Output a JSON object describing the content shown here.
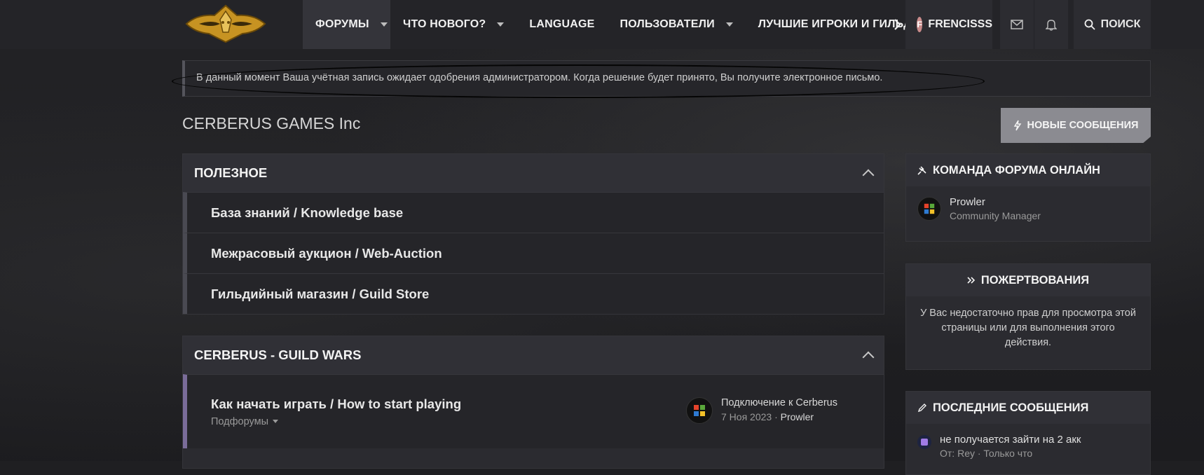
{
  "nav": {
    "items": [
      {
        "label": "ФОРУМЫ",
        "active": true,
        "dropdown": true
      },
      {
        "label": "ЧТО НОВОГО?",
        "dropdown": true
      },
      {
        "label": "LANGUAGE",
        "dropdown": false
      },
      {
        "label": "ПОЛЬЗОВАТЕЛИ",
        "dropdown": true
      },
      {
        "label": "ЛУЧШИЕ ИГРОКИ И ГИЛЬДИ",
        "dropdown": false
      }
    ],
    "more_icon": "chevron-right-icon",
    "user": {
      "initial": "F",
      "name": "FRENCISSS"
    },
    "mail_icon": "mail-icon",
    "bell_icon": "bell-icon",
    "search_label": "ПОИСК"
  },
  "notice": {
    "text": "В данный момент Ваша учётная запись ожидает одобрения администратором. Когда решение будет принято, Вы получите электронное письмо."
  },
  "page": {
    "title": "CERBERUS GAMES Inc",
    "new_posts_label": "НОВЫЕ СООБЩЕНИЯ"
  },
  "categories": [
    {
      "title": "ПОЛЕЗНОЕ",
      "forums": [
        {
          "title": "База знаний / Knowledge base"
        },
        {
          "title": "Межрасовый аукцион / Web-Auction"
        },
        {
          "title": "Гильдийный магазин / Guild Store"
        }
      ]
    },
    {
      "title": "CERBERUS - GUILD WARS",
      "forums": [
        {
          "title": "Как начать играть / How to start playing",
          "subforums_label": "Подфорумы",
          "last_post": {
            "title": "Подключение к Cerberus",
            "date": "7 Ноя 2023",
            "sep": "·",
            "author": "Prowler"
          }
        }
      ]
    }
  ],
  "sidebar": {
    "staff": {
      "title": "КОМАНДА ФОРУМА ОНЛАЙН",
      "member": {
        "name": "Prowler",
        "role": "Community Manager"
      }
    },
    "donations": {
      "title": "ПОЖЕРТВОВАНИЯ",
      "text": "У Вас недостаточно прав для просмотра этой страницы или для выполнения этого действия."
    },
    "latest": {
      "title": "ПОСЛЕДНИЕ СООБЩЕНИЯ",
      "post": {
        "title": "не получается зайти на 2 акк",
        "meta": "От: Rey · Только что"
      }
    }
  }
}
